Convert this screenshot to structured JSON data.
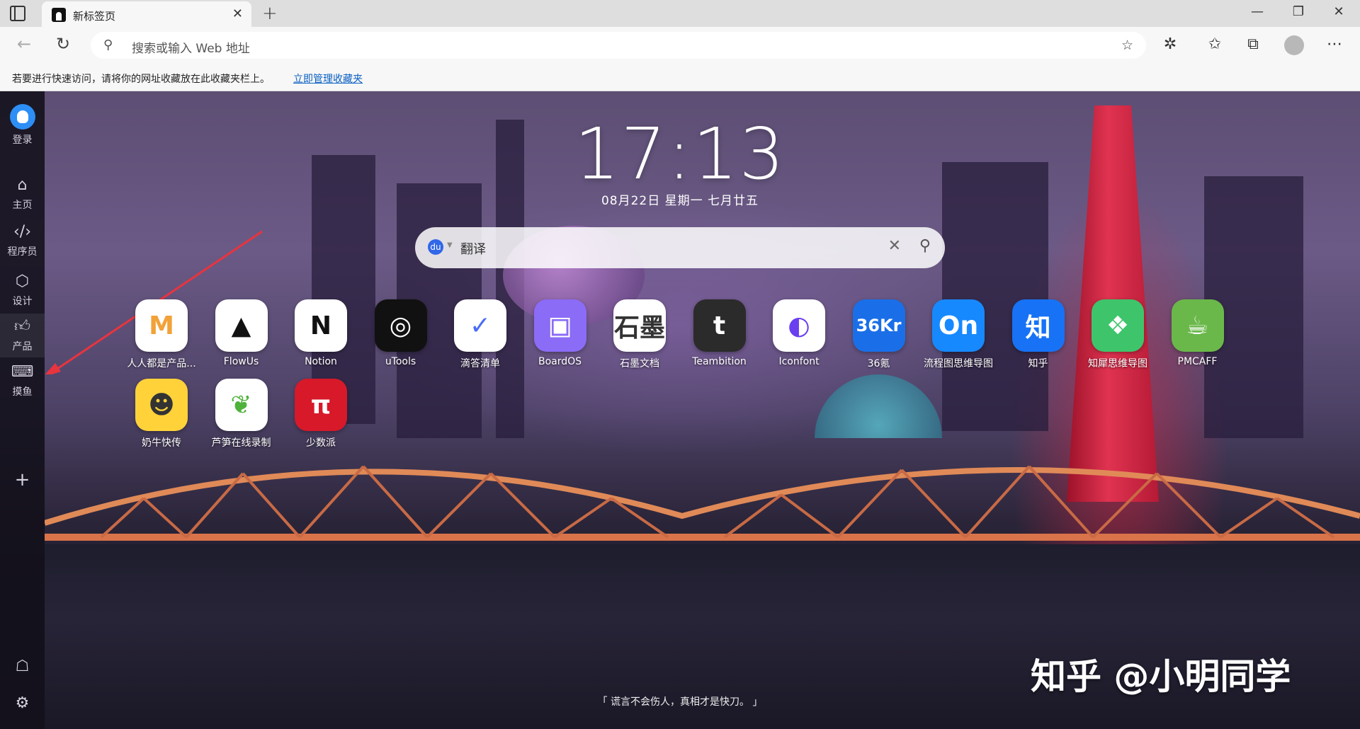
{
  "browser": {
    "tab_title": "新标签页",
    "address_placeholder": "搜索或输入 Web 地址",
    "bookmark_hint": "若要进行快速访问，请将你的网址收藏放在此收藏夹栏上。",
    "bookmark_link": "立即管理收藏夹"
  },
  "sidebar": {
    "login": "登录",
    "items": [
      {
        "label": "主页",
        "icon": "home-icon"
      },
      {
        "label": "程序员",
        "icon": "code-icon"
      },
      {
        "label": "设计",
        "icon": "cube-icon"
      },
      {
        "label": "产品",
        "icon": "thumbs-up-icon"
      },
      {
        "label": "摸鱼",
        "icon": "gamepad-icon"
      }
    ]
  },
  "clock": {
    "time": "17:13",
    "date": "08月22日  星期一  七月廿五"
  },
  "search": {
    "query": "翻译",
    "engine_icon": "baidu-icon"
  },
  "apps_row1": [
    {
      "label": "人人都是产品...",
      "glyph": "M",
      "bg": "#ffffff",
      "fg": "#f2a23a"
    },
    {
      "label": "FlowUs",
      "glyph": "▲",
      "bg": "#ffffff",
      "fg": "#111111"
    },
    {
      "label": "Notion",
      "glyph": "N",
      "bg": "#ffffff",
      "fg": "#111111"
    },
    {
      "label": "uTools",
      "glyph": "◎",
      "bg": "#111111",
      "fg": "#ffffff"
    },
    {
      "label": "滴答清单",
      "glyph": "✓",
      "bg": "#ffffff",
      "fg": "#4a6cf7"
    },
    {
      "label": "BoardOS",
      "glyph": "▣",
      "bg": "#8b6cf6",
      "fg": "#ffffff"
    },
    {
      "label": "石墨文档",
      "glyph": "石墨",
      "bg": "#ffffff",
      "fg": "#333333"
    },
    {
      "label": "Teambition",
      "glyph": "t",
      "bg": "#2b2b2b",
      "fg": "#ffffff"
    },
    {
      "label": "Iconfont",
      "glyph": "◐",
      "bg": "#ffffff",
      "fg": "#6a3ff0"
    },
    {
      "label": "36氪",
      "glyph": "36Kr",
      "bg": "#1a6fe8",
      "fg": "#ffffff"
    },
    {
      "label": "流程图思维导图",
      "glyph": "On",
      "bg": "#1789ff",
      "fg": "#ffffff"
    },
    {
      "label": "知乎",
      "glyph": "知",
      "bg": "#1772f6",
      "fg": "#ffffff"
    },
    {
      "label": "知犀思维导图",
      "glyph": "❖",
      "bg": "#3ec46a",
      "fg": "#ffffff"
    },
    {
      "label": "PMCAFF",
      "glyph": "☕",
      "bg": "#6ab84a",
      "fg": "#ffffff"
    }
  ],
  "apps_row2": [
    {
      "label": "奶牛快传",
      "glyph": "☻",
      "bg": "#ffd23a",
      "fg": "#333333"
    },
    {
      "label": "芦笋在线录制",
      "glyph": "❦",
      "bg": "#ffffff",
      "fg": "#4fb23b"
    },
    {
      "label": "少数派",
      "glyph": "π",
      "bg": "#d7192a",
      "fg": "#ffffff"
    }
  ],
  "quote": "「 谎言不会伤人，真相才是快刀。 」",
  "watermark": "知乎 @小明同学"
}
